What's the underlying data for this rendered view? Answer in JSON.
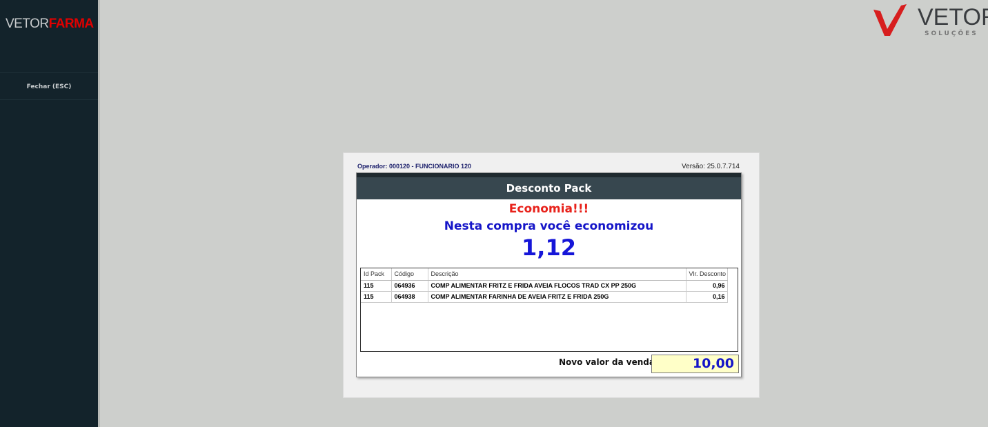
{
  "sidebar": {
    "brand_a": "VETOR",
    "brand_b": "FARMA",
    "close_label": "Fechar (ESC)"
  },
  "logo": {
    "title": "VETOR",
    "subtitle": "SOLUÇÕES"
  },
  "header": {
    "operator": "Operador: 000120 - FUNCIONARIO 120",
    "version": "Versão: 25.0.7.714"
  },
  "dialog": {
    "title": "Desconto Pack",
    "headline": "Economia!!!",
    "message": "Nesta compra você economizou",
    "savings": "1,12",
    "columns": [
      "Id Pack",
      "Código",
      "Descrição",
      "Vlr. Desconto"
    ],
    "rows": [
      [
        "115",
        "064936",
        "COMP ALIMENTAR FRITZ E FRIDA AVEIA FLOCOS TRAD CX PP 250G",
        "0,96"
      ],
      [
        "115",
        "064938",
        "COMP ALIMENTAR FARINHA DE AVEIA FRITZ E FRIDA 250G",
        "0,16"
      ]
    ],
    "new_total_label": "Novo valor da venda:",
    "new_total": "10,00"
  },
  "colors": {
    "accent_red": "#e8221b",
    "accent_blue": "#1515c8",
    "sidebar": "#13232b"
  }
}
